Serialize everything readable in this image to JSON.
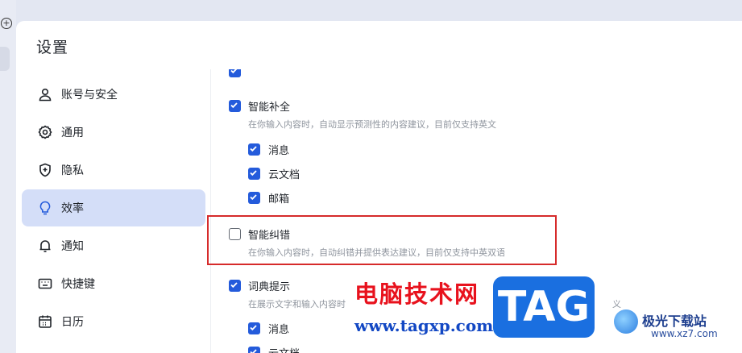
{
  "window": {
    "title": "设置"
  },
  "sidebar": {
    "items": [
      {
        "label": "账号与安全",
        "icon": "user-icon",
        "active": false
      },
      {
        "label": "通用",
        "icon": "gear-icon",
        "active": false
      },
      {
        "label": "隐私",
        "icon": "shield-icon",
        "active": false
      },
      {
        "label": "效率",
        "icon": "bulb-icon",
        "active": true
      },
      {
        "label": "通知",
        "icon": "bell-icon",
        "active": false
      },
      {
        "label": "快捷键",
        "icon": "keyboard-icon",
        "active": false
      },
      {
        "label": "日历",
        "icon": "calendar-icon",
        "active": false
      }
    ]
  },
  "content": {
    "top_partial": {
      "checked": true
    },
    "smart_complete": {
      "label": "智能补全",
      "checked": true,
      "desc": "在你输入内容时，自动显示预测性的内容建议，目前仅支持英文",
      "subs": [
        {
          "label": "消息",
          "checked": true
        },
        {
          "label": "云文档",
          "checked": true
        },
        {
          "label": "邮箱",
          "checked": true
        }
      ]
    },
    "smart_correct": {
      "label": "智能纠错",
      "checked": false,
      "desc": "在你输入内容时，自动纠错并提供表达建议，目前仅支持中英双语"
    },
    "dictionary_hint": {
      "label": "词典提示",
      "checked": true,
      "desc": "在展示文字和输入内容时",
      "desc_tail": "义",
      "subs": [
        {
          "label": "消息",
          "checked": true
        },
        {
          "label": "云文档",
          "checked": true
        }
      ]
    }
  },
  "watermark": {
    "cn_text": "电脑技术网",
    "url": "www.tagxp.com",
    "tag": "TAG",
    "logo_text": "极光下载站",
    "logo_url": "www.xz7.com"
  },
  "colors": {
    "accent": "#245bdb",
    "active_nav": "#d4def8",
    "highlight": "#d62b2b"
  }
}
